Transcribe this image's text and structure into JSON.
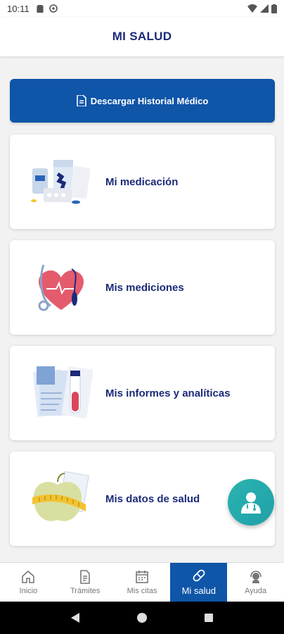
{
  "status_bar": {
    "time": "10:11"
  },
  "app_bar": {
    "title": "MI SALUD"
  },
  "download_button": {
    "label": "Descargar Historial Médico"
  },
  "cards": [
    {
      "label": "Mi medicación",
      "icon": "medication-illustration"
    },
    {
      "label": "Mis mediciones",
      "icon": "heart-stethoscope-illustration"
    },
    {
      "label": "Mis informes y analíticas",
      "icon": "reports-bloodtube-illustration"
    },
    {
      "label": "Mis datos de salud",
      "icon": "apple-measuring-tape-illustration"
    }
  ],
  "bottom_nav": [
    {
      "label": "Inicio",
      "icon": "home-icon"
    },
    {
      "label": "Trámites",
      "icon": "document-icon"
    },
    {
      "label": "Mis citas",
      "icon": "calendar-icon"
    },
    {
      "label": "Mi salud",
      "icon": "pill-icon",
      "active": true
    },
    {
      "label": "Ayuda",
      "icon": "help-agent-icon"
    }
  ],
  "colors": {
    "primary": "#0f55a8",
    "title": "#1c2a78",
    "fab": "#2bb3b0"
  }
}
